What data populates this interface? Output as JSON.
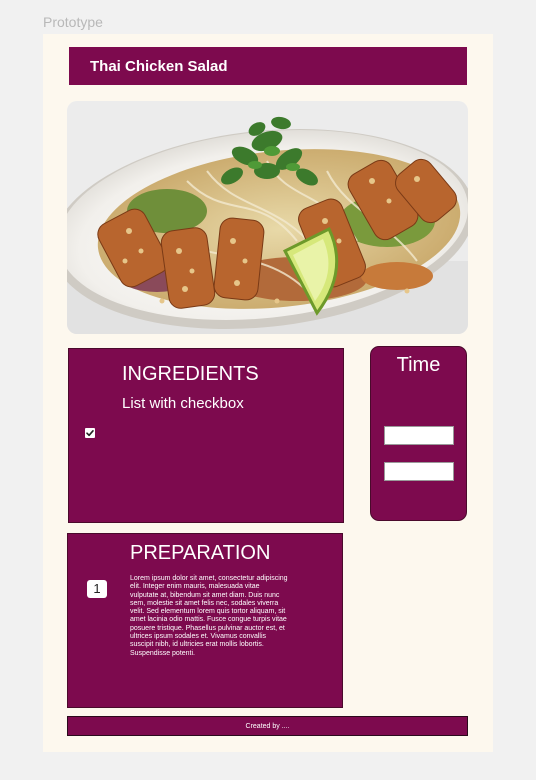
{
  "prototype_label": "Prototype",
  "recipe": {
    "title": "Thai Chicken Salad"
  },
  "colors": {
    "primary": "#7d0a4e",
    "background": "#fdf8ee",
    "canvas": "#f1f1f1"
  },
  "hero_image": {
    "subject": "Thai chicken salad on a white oval plate"
  },
  "ingredients": {
    "title": "INGREDIENTS",
    "subtitle": "List with checkbox",
    "checkbox_checked": true
  },
  "time": {
    "title": "Time"
  },
  "preparation": {
    "title": "PREPARATION",
    "step_number": "1",
    "step_text": "Lorem ipsum dolor sit amet, consectetur adipiscing elit. Integer enim mauris, malesuada vitae vulputate at, bibendum sit amet diam. Duis nunc sem, molestie sit amet felis nec, sodales viverra velit. Sed elementum lorem quis tortor aliquam, sit amet lacinia odio mattis. Fusce congue turpis vitae posuere tristique. Phasellus pulvinar auctor est, et ultrices ipsum sodales et. Vivamus convallis suscipit nibh, id ultricies erat mollis lobortis. Suspendisse potenti."
  },
  "footer": {
    "text": "Created by ...."
  }
}
